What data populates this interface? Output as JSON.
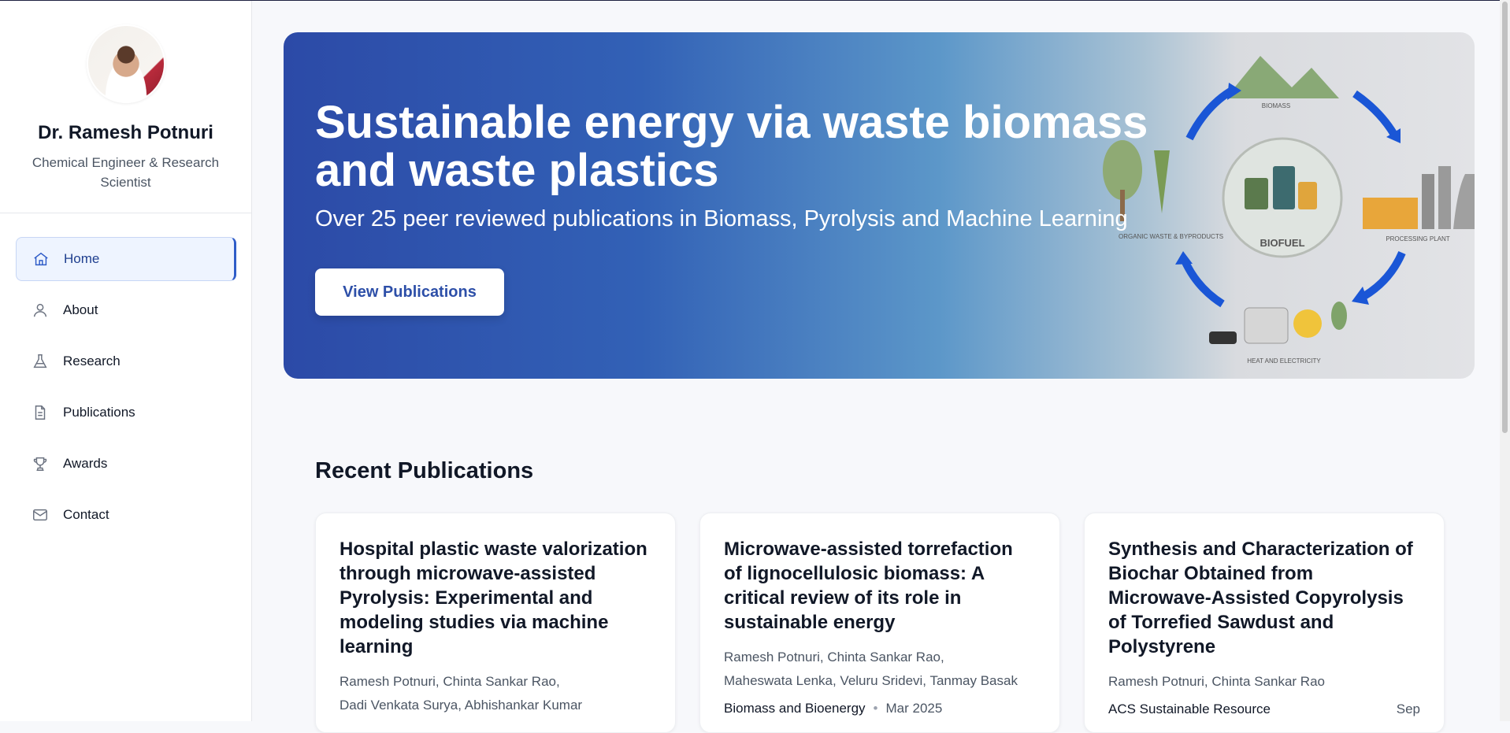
{
  "profile": {
    "name": "Dr. Ramesh Potnuri",
    "subtitle": "Chemical Engineer & Research Scientist"
  },
  "nav": [
    {
      "label": "Home",
      "icon": "home-icon",
      "active": true
    },
    {
      "label": "About",
      "icon": "user-icon"
    },
    {
      "label": "Research",
      "icon": "flask-icon"
    },
    {
      "label": "Publications",
      "icon": "document-icon"
    },
    {
      "label": "Awards",
      "icon": "trophy-icon"
    },
    {
      "label": "Contact",
      "icon": "mail-icon"
    }
  ],
  "hero": {
    "title": "Sustainable energy via waste biomass and waste plastics",
    "subtitle": "Over 25 peer reviewed publications in Biomass, Pyrolysis and Machine Learning",
    "button": "View Publications",
    "art_labels": {
      "biomass": "BIOMASS",
      "biofuel": "BIOFUEL",
      "plant": "PROCESSING PLANT",
      "heat": "HEAT AND ELECTRICITY",
      "organic": "ORGANIC WASTE & BYPRODUCTS"
    }
  },
  "recent": {
    "title": "Recent Publications",
    "cards": [
      {
        "title": "Hospital plastic waste valorization through microwave-assisted Pyrolysis: Experimental and modeling studies via machine learning",
        "authors_line1": "Ramesh Potnuri, Chinta Sankar Rao,",
        "authors_line2": "Dadi Venkata Surya, Abhishankar Kumar",
        "journal": "",
        "date": ""
      },
      {
        "title": "Microwave-assisted torrefaction of lignocellulosic biomass: A critical review of its role in sustainable energy",
        "authors_line1": "Ramesh Potnuri, Chinta Sankar Rao,",
        "authors_line2": "Maheswata Lenka, Veluru Sridevi, Tanmay Basak",
        "journal": "Biomass and Bioenergy",
        "date": "Mar 2025"
      },
      {
        "title": "Synthesis and Characterization of Biochar Obtained from Microwave-Assisted Copyrolysis of Torrefied Sawdust and Polystyrene",
        "authors_line1": "Ramesh Potnuri, Chinta Sankar Rao",
        "authors_line2": "",
        "journal": "ACS Sustainable Resource",
        "date": "Sep"
      }
    ]
  }
}
